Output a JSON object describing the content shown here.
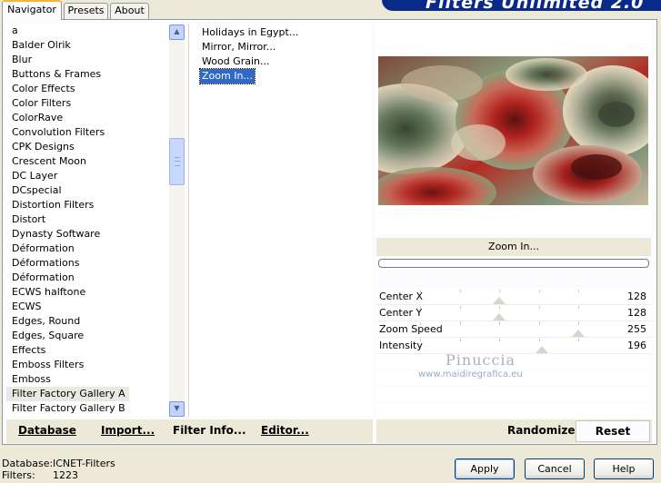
{
  "tabs": [
    {
      "label": "Navigator",
      "active": true
    },
    {
      "label": "Presets",
      "active": false
    },
    {
      "label": "About",
      "active": false
    }
  ],
  "banner": {
    "text": "Filters Unlimited 2.0"
  },
  "categories": {
    "items": [
      "a",
      "Balder Olrik",
      "Blur",
      "Buttons & Frames",
      "Color Effects",
      "Color Filters",
      "ColorRave",
      "Convolution Filters",
      "CPK Designs",
      "Crescent Moon",
      "DC Layer",
      "DCspecial",
      "Distortion Filters",
      "Distort",
      "Dynasty Software",
      "Déformation",
      "Déformations",
      "Déformation",
      "ECWS halftone",
      "ECWS",
      "Edges, Round",
      "Edges, Square",
      "Effects",
      "Emboss Filters",
      "Emboss",
      "Filter Factory Gallery A",
      "Filter Factory Gallery B"
    ],
    "selected": "Filter Factory Gallery A"
  },
  "scrollbar": {
    "up_icon": "▲",
    "down_icon": "▼"
  },
  "filters": {
    "items": [
      "Holidays in Egypt...",
      "Mirror, Mirror...",
      "Wood Grain...",
      "Zoom In..."
    ],
    "selected": "Zoom In..."
  },
  "preview": {
    "filter_name": "Zoom In...",
    "progress": 0.0,
    "colors": {
      "red": "#b3241f",
      "green": "#6f8a63",
      "cream": "#e8dcc2"
    }
  },
  "params": [
    {
      "label": "Center X",
      "value": "128",
      "level": 0.502
    },
    {
      "label": "Center Y",
      "value": "128",
      "level": 0.502
    },
    {
      "label": "Zoom Speed",
      "value": "255",
      "level": 1.0
    },
    {
      "label": "Intensity",
      "value": "196",
      "level": 0.769
    }
  ],
  "watermark": {
    "line1": "Pinuccia",
    "line2": "www.maidiregrafica.eu"
  },
  "toolbar": {
    "database": "Database",
    "import": "Import...",
    "filter_info": "Filter Info...",
    "editor": "Editor...",
    "randomize": "Randomize",
    "reset": "Reset"
  },
  "status": {
    "database_label": "Database:",
    "database_value": "ICNET-Filters",
    "filters_label": "Filters:",
    "filters_value": "1223"
  },
  "buttons": {
    "apply": "Apply",
    "cancel": "Cancel",
    "help": "Help"
  }
}
